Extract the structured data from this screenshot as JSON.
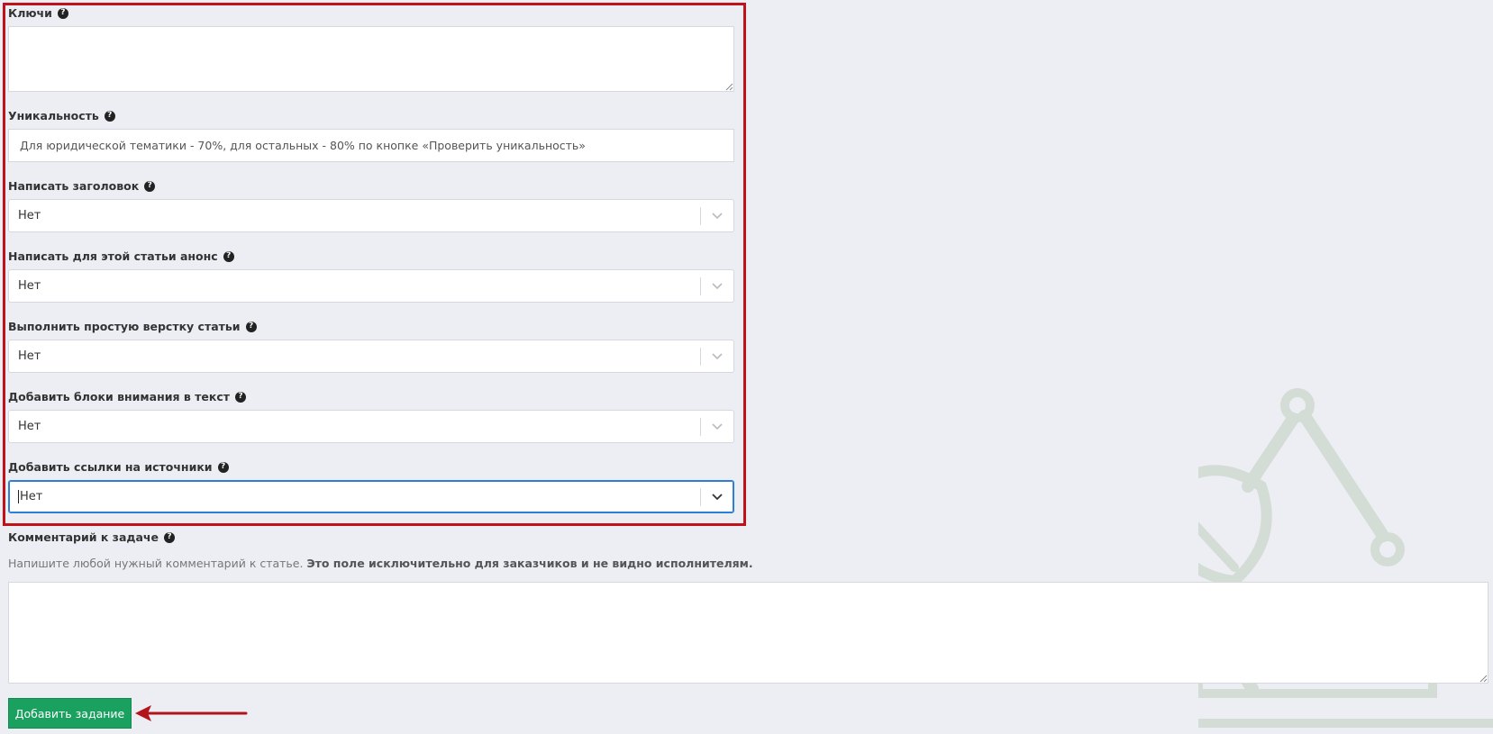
{
  "form": {
    "keys": {
      "label": "Ключи",
      "value": ""
    },
    "uniqueness": {
      "label": "Уникальность",
      "placeholder": "Для юридической тематики - 70%, для остальных - 80% по кнопке «Проверить уникальность»"
    },
    "write_title": {
      "label": "Написать заголовок",
      "value": "Нет"
    },
    "write_announce": {
      "label": "Написать для этой статьи анонс",
      "value": "Нет"
    },
    "simple_layout": {
      "label": "Выполнить простую верстку статьи",
      "value": "Нет"
    },
    "attention_blocks": {
      "label": "Добавить блоки внимания в текст",
      "value": "Нет"
    },
    "source_links": {
      "label": "Добавить ссылки на источники",
      "value": "Нет"
    },
    "comment": {
      "label": "Комментарий к задаче",
      "hint_normal": "Напишите любой нужный комментарий к статье.",
      "hint_bold": "Это поле исключительно для заказчиков и не видно исполнителям.",
      "value": ""
    },
    "submit_label": "Добавить задание"
  },
  "icons": {
    "help": "question-circle-icon",
    "dropdown": "chevron-down-icon",
    "decoration": "desk-lamp-icon"
  },
  "colors": {
    "background": "#eceef4",
    "highlight": "#c0121a",
    "submit": "#1aa15f",
    "focus": "#2d7fd3"
  }
}
